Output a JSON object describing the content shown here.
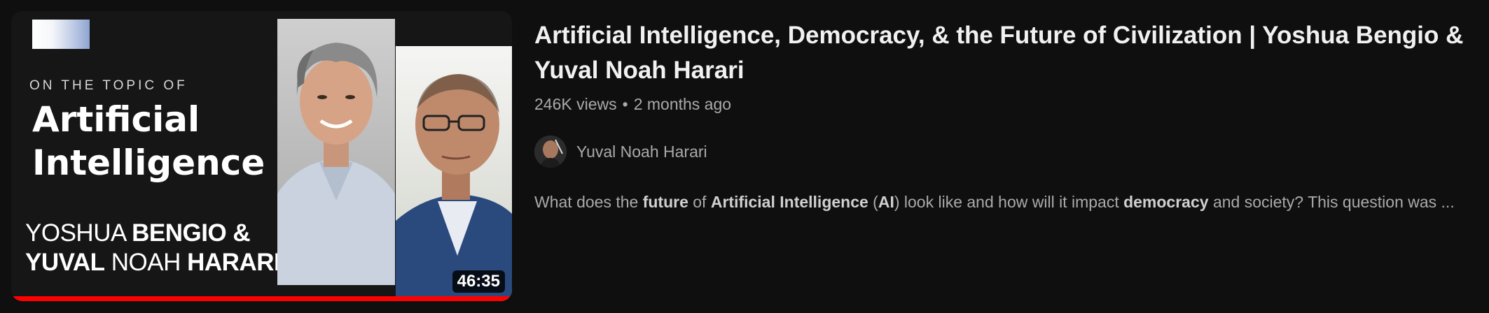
{
  "thumbnail": {
    "topic_kicker": "ON THE TOPIC OF",
    "topic_line_1": "Artificial",
    "topic_line_2": "Intelligence",
    "guest_1_first": "YOSHUA",
    "guest_1_last": "BENGIO &",
    "guest_2_first": "YUVAL",
    "guest_2_middle": "NOAH",
    "guest_2_last": "HARARI",
    "duration": "46:35",
    "watch_progress_percent": 100,
    "progress_color": "#ff0000"
  },
  "video": {
    "title": "Artificial Intelligence, Democracy, & the Future of Civilization | Yoshua Bengio & Yuval Noah Harari",
    "views": "246K views",
    "separator": "•",
    "age": "2 months ago",
    "channel_name": "Yuval Noah Harari",
    "description": {
      "p1": "What does the ",
      "b1": "future",
      "p2": " of ",
      "b2": "Artificial Intelligence",
      "p3": " (",
      "b3": "AI",
      "p4": ") look like and how will it impact ",
      "b4": "democracy",
      "p5": " and society? This question was ..."
    }
  },
  "icons": [
    "avatar-image",
    "bengio-portrait",
    "harari-portrait",
    "channel-logo"
  ]
}
